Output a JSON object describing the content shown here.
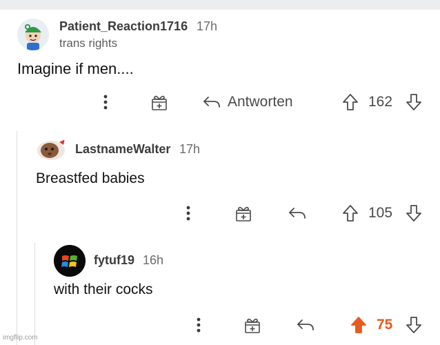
{
  "comments": [
    {
      "username": "Patient_Reaction1716",
      "time": "17h",
      "flair": "trans rights",
      "body": "Imagine if men....",
      "reply_label": "Antworten",
      "votes": "162",
      "upvoted": false
    },
    {
      "username": "LastnameWalter",
      "time": "17h",
      "body": "Breastfed babies",
      "votes": "105",
      "upvoted": false
    },
    {
      "username": "fytuf19",
      "time": "16h",
      "body": "with their cocks",
      "votes": "75",
      "upvoted": true
    }
  ],
  "colors": {
    "upvote_active": "#e85a1f",
    "text_muted": "#6b6b6b"
  },
  "icons": [
    "more-options-icon",
    "gift-award-icon",
    "reply-icon",
    "upvote-arrow-icon",
    "downvote-arrow-icon"
  ],
  "watermark": "imgflip.com"
}
